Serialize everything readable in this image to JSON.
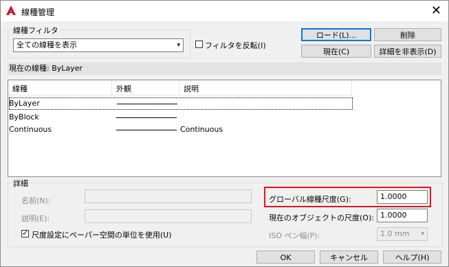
{
  "window": {
    "title": "線種管理"
  },
  "filter": {
    "group_label": "線種フィルタ",
    "selected": "全ての線種を表示",
    "invert_label": "フィルタを反転(I)",
    "invert_checked": false
  },
  "buttons": {
    "load": "ロード(L)...",
    "delete": "削除",
    "current": "現在(C)",
    "toggle_details": "詳細を非表示(D)",
    "ok": "OK",
    "cancel": "キャンセル",
    "help": "ヘルプ(H)"
  },
  "current_linetype": "現在の線種:  ByLayer",
  "table": {
    "columns": [
      "線種",
      "外観",
      "説明"
    ],
    "rows": [
      {
        "name": "ByLayer",
        "description": "",
        "has_sample": true
      },
      {
        "name": "ByBlock",
        "description": "",
        "has_sample": true
      },
      {
        "name": "Continuous",
        "description": "Continuous",
        "has_sample": true
      }
    ]
  },
  "details": {
    "group_label": "詳細",
    "name_label": "名前(N):",
    "name_value": "",
    "desc_label": "説明(E):",
    "desc_value": "",
    "paper_space_label": "尺度設定にペーパー空間の単位を使用(U)",
    "paper_space_checked": true,
    "global_scale_label": "グローバル線種尺度(G):",
    "global_scale_value": "1.0000",
    "object_scale_label": "現在のオブジェクトの尺度(O):",
    "object_scale_value": "1.0000",
    "pen_width_label": "ISO ペン幅(P):",
    "pen_width_value": "1.0 mm"
  },
  "colors": {
    "highlight": "#e0141e",
    "default_button_border": "#0078d7",
    "app_icon": "#c8102e"
  }
}
